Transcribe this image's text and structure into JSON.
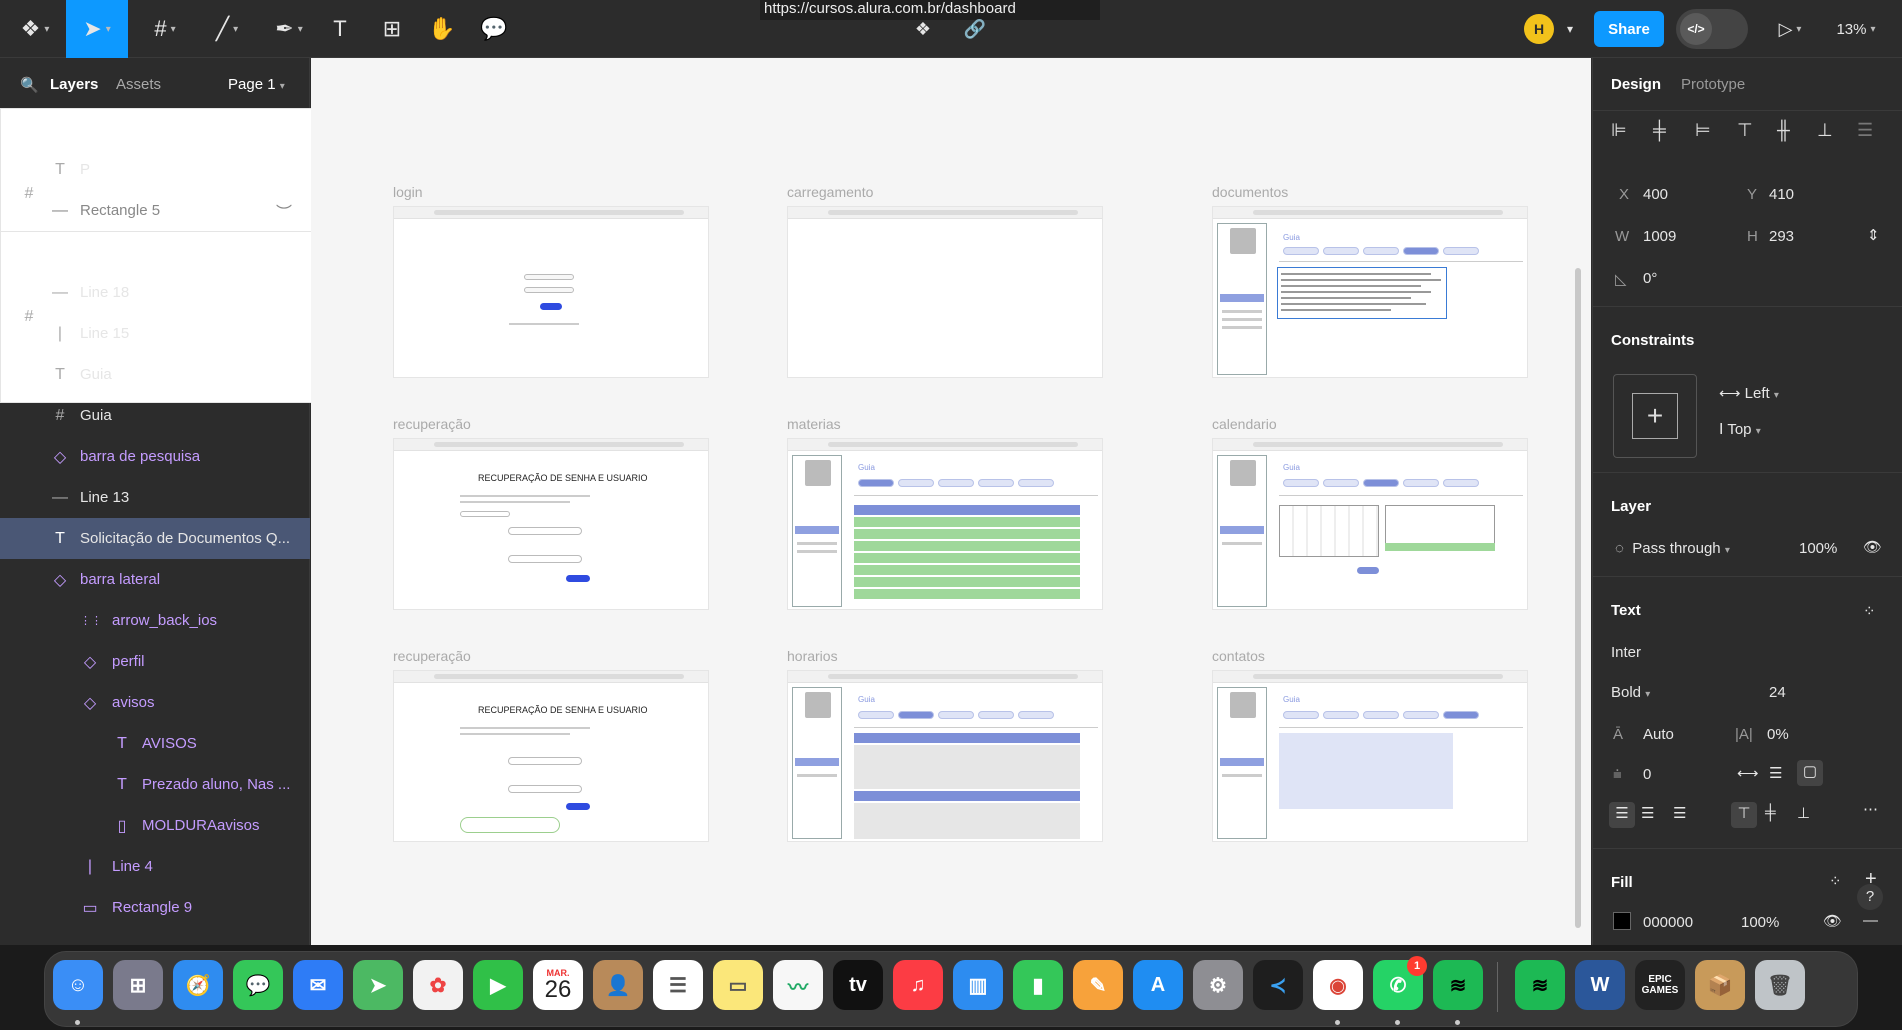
{
  "toolbar": {
    "url": "https://cursos.alura.com.br/dashboard",
    "avatar_initial": "H",
    "share_label": "Share",
    "code_label": "</>",
    "zoom": "13%"
  },
  "left_panel": {
    "tab_layers": "Layers",
    "tab_assets": "Assets",
    "page_selector": "Page 1",
    "layers": [
      {
        "label": "calendario",
        "icon": "#",
        "kind": "frame"
      },
      {
        "label": "P",
        "icon": "T",
        "kind": "text"
      },
      {
        "label": "Rectangle 5",
        "icon": "—",
        "kind": "dim"
      },
      {
        "label": "documentos",
        "icon": "#",
        "kind": "frame"
      },
      {
        "label": "Line 18",
        "icon": "—",
        "kind": "line"
      },
      {
        "label": "Line 15",
        "icon": "|",
        "kind": "line"
      },
      {
        "label": "Guia",
        "icon": "T",
        "kind": "text"
      },
      {
        "label": "Guia",
        "icon": "#",
        "kind": "frame-child"
      },
      {
        "label": "barra de pesquisa",
        "icon": "◇",
        "kind": "comp"
      },
      {
        "label": "Line 13",
        "icon": "—",
        "kind": "line"
      },
      {
        "label": "Solicitação de Documentos Q...",
        "icon": "T",
        "kind": "selected"
      },
      {
        "label": "barra lateral",
        "icon": "◇",
        "kind": "comp"
      },
      {
        "label": "arrow_back_ios",
        "icon": "⋮⋮",
        "kind": "comp"
      },
      {
        "label": "perfil",
        "icon": "◇",
        "kind": "comp"
      },
      {
        "label": "avisos",
        "icon": "◇",
        "kind": "comp"
      },
      {
        "label": "AVISOS",
        "icon": "T",
        "kind": "comp"
      },
      {
        "label": "Prezado aluno, Nas ...",
        "icon": "T",
        "kind": "comp"
      },
      {
        "label": "MOLDURAavisos",
        "icon": "▯",
        "kind": "comp"
      },
      {
        "label": "Line 4",
        "icon": "|",
        "kind": "comp"
      },
      {
        "label": "Rectangle 9",
        "icon": "▭",
        "kind": "comp"
      }
    ]
  },
  "canvas": {
    "frames": [
      {
        "label": "login"
      },
      {
        "label": "carregamento"
      },
      {
        "label": "documentos"
      },
      {
        "label": "recuperação"
      },
      {
        "label": "materias"
      },
      {
        "label": "calendario"
      },
      {
        "label": "recuperação"
      },
      {
        "label": "horarios"
      },
      {
        "label": "contatos"
      }
    ],
    "recovery_title": "RECUPERAÇÃO DE SENHA E USUARIO",
    "guia_label": "Guia"
  },
  "right_panel": {
    "tab_design": "Design",
    "tab_prototype": "Prototype",
    "x_label": "X",
    "x_value": "400",
    "y_label": "Y",
    "y_value": "410",
    "w_label": "W",
    "w_value": "1009",
    "h_label": "H",
    "h_value": "293",
    "rotation": "0°",
    "constraints_title": "Constraints",
    "constraint_h": "Left",
    "constraint_v": "Top",
    "layer_title": "Layer",
    "blend_mode": "Pass through",
    "opacity": "100%",
    "text_title": "Text",
    "font_family": "Inter",
    "font_weight": "Bold",
    "font_size": "24",
    "line_height": "Auto",
    "letter_spacing": "0%",
    "paragraph_spacing": "0",
    "fill_title": "Fill",
    "fill_hex": "000000",
    "fill_opacity": "100%",
    "help": "?"
  },
  "dock": {
    "calendar_month": "MAR.",
    "calendar_day": "26",
    "whatsapp_badge": "1",
    "apple_tv": "tv",
    "epic": "EPIC GAMES",
    "word": "W"
  }
}
